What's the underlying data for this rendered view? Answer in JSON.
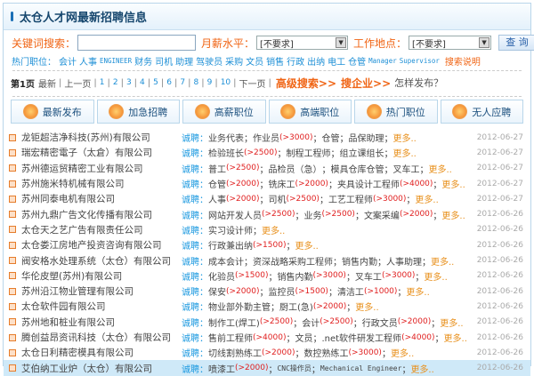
{
  "title": "太仓人才网最新招聘信息",
  "search": {
    "keyword_label": "关键词搜索：",
    "keyword_value": "",
    "salary_label": "月薪水平：",
    "salary_value": "[不要求]",
    "location_label": "工作地点：",
    "location_value": "[不要求]",
    "button": "查 询"
  },
  "hot": {
    "label": "热门职位：",
    "items": [
      "会计",
      "人事",
      "ENGINEER",
      "财务",
      "司机",
      "助理",
      "驾驶员",
      "采购",
      "文员",
      "销售",
      "行政",
      "出纳",
      "电工",
      "仓管",
      "Manager",
      "Supervisor"
    ],
    "explain": "搜索说明"
  },
  "pager": {
    "current": "第1页",
    "latest": "最新",
    "prev": "上一页",
    "pages": [
      "1",
      "2",
      "3",
      "4",
      "5",
      "6",
      "7",
      "8",
      "9",
      "10"
    ],
    "next": "下一页",
    "advanced": "高级搜索>>",
    "company": "搜企业>>",
    "howto": "怎样发布？"
  },
  "categories": [
    {
      "label": "最新发布",
      "icon": "new-icon"
    },
    {
      "label": "加急招聘",
      "icon": "speaker-icon"
    },
    {
      "label": "高薪职位",
      "icon": "money-icon"
    },
    {
      "label": "高端职位",
      "icon": "diamond-icon"
    },
    {
      "label": "热门职位",
      "icon": "people-icon"
    },
    {
      "label": "无人应聘",
      "icon": "bulb-icon"
    }
  ],
  "recruit_label": "诚聘：",
  "more_label": "更多..",
  "rows": [
    {
      "company": "龙钜超洁净科技(苏州)有限公司",
      "jobs": [
        [
          "业务代表",
          ""
        ],
        [
          "作业员",
          "(>3000)"
        ],
        [
          "仓管",
          ""
        ],
        [
          "品保助理",
          ""
        ]
      ],
      "date": "2012-06-27"
    },
    {
      "company": "瑞宏精密電子（太倉）有限公司",
      "jobs": [
        [
          "检验班长",
          "(>2500)"
        ],
        [
          "制程工程师",
          ""
        ],
        [
          "组立课组长",
          ""
        ]
      ],
      "date": "2012-06-27"
    },
    {
      "company": "苏州德运贸精密工业有限公司",
      "jobs": [
        [
          "普工",
          "(>2500)"
        ],
        [
          "品检员（急）",
          ""
        ],
        [
          "模具仓库仓管",
          ""
        ],
        [
          "叉车工",
          ""
        ]
      ],
      "date": "2012-06-27"
    },
    {
      "company": "苏州施米特机械有限公司",
      "jobs": [
        [
          "仓管",
          "(>2000)"
        ],
        [
          "铣床工",
          "(>2000)"
        ],
        [
          "夹具设计工程师",
          "(>4000)"
        ]
      ],
      "date": "2012-06-27"
    },
    {
      "company": "苏州同泰电机有限公司",
      "jobs": [
        [
          "人事",
          "(>2000)"
        ],
        [
          "司机",
          "(>2500)"
        ],
        [
          "工艺工程师",
          "(>3000)"
        ]
      ],
      "date": "2012-06-27"
    },
    {
      "company": "苏州九鼎广告文化传播有限公司",
      "jobs": [
        [
          "网站开发人员",
          "(>2500)"
        ],
        [
          "业务",
          "(>2500)"
        ],
        [
          "文案采编",
          "(>2000)"
        ]
      ],
      "date": "2012-06-26"
    },
    {
      "company": "太仓天之艺广告有限责任公司",
      "jobs": [
        [
          "实习设计师",
          ""
        ]
      ],
      "date": "2012-06-26"
    },
    {
      "company": "太仓娄江房地产投资咨询有限公司",
      "jobs": [
        [
          "行政兼出纳",
          "(>1500)"
        ]
      ],
      "date": "2012-06-26"
    },
    {
      "company": "阀安格水处理系统（太仓）有限公司",
      "jobs": [
        [
          "成本会计 ",
          ""
        ],
        [
          "资深战略采购工程师",
          ""
        ],
        [
          "销售内勤",
          ""
        ],
        [
          "人事助理",
          ""
        ]
      ],
      "date": "2012-06-26"
    },
    {
      "company": "华伦皮塑(苏州)有限公司",
      "jobs": [
        [
          "化验员",
          "(>1500)"
        ],
        [
          "销售内勤",
          "(>3000)"
        ],
        [
          "叉车工",
          "(>3000)"
        ]
      ],
      "date": "2012-06-26"
    },
    {
      "company": "苏州沿江物业管理有限公司",
      "jobs": [
        [
          "保安",
          "(>2000)"
        ],
        [
          "监控员",
          "(>1500)"
        ],
        [
          "清洁工",
          "(>1000)"
        ]
      ],
      "date": "2012-06-26"
    },
    {
      "company": "太仓软件园有限公司",
      "jobs": [
        [
          "物业部外勤主管",
          ""
        ],
        [
          "厨工(急)",
          "(>2000)"
        ]
      ],
      "date": "2012-06-26"
    },
    {
      "company": "苏州地和桩业有限公司",
      "jobs": [
        [
          "制作工(焊工)",
          "(>2500)"
        ],
        [
          "会计",
          "(>2500)"
        ],
        [
          "行政文员",
          "(>2000)"
        ]
      ],
      "date": "2012-06-26"
    },
    {
      "company": "腾创益昂资讯科技（太仓）有限公司",
      "jobs": [
        [
          "售前工程师",
          "(>4000)"
        ],
        [
          "文员",
          ""
        ],
        [
          ".net软件研发工程师",
          "(>4000)"
        ]
      ],
      "date": "2012-06-26"
    },
    {
      "company": "太仓日利精密模具有限公司",
      "jobs": [
        [
          "切线割熟练工",
          "(>2000)"
        ],
        [
          "数控熟练工",
          "(>3000)"
        ]
      ],
      "date": "2012-06-26"
    },
    {
      "company": "艾伯纳工业炉（太仓）有限公司",
      "jobs": [
        [
          "喷漆工",
          "(>2000)"
        ],
        [
          "CNC操作员",
          ""
        ],
        [
          "Mechanical Engineer",
          ""
        ]
      ],
      "date": "2012-06-26"
    }
  ]
}
